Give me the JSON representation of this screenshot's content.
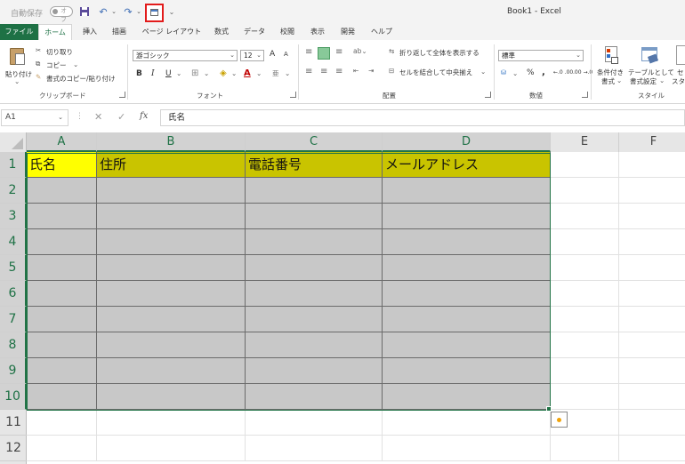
{
  "titlebar": {
    "autosave_label": "自動保存",
    "autosave_state": "オフ",
    "filename": "Book1  -  Excel"
  },
  "tabs": [
    "ファイル",
    "ホーム",
    "挿入",
    "描画",
    "ページ レイアウト",
    "数式",
    "データ",
    "校閲",
    "表示",
    "開発",
    "ヘルプ"
  ],
  "ribbon": {
    "clipboard": {
      "paste": "貼り付け",
      "cut": "切り取り",
      "copy": "コピー",
      "format_painter": "書式のコピー/貼り付け",
      "group": "クリップボード"
    },
    "font": {
      "font_name": "游ゴシック",
      "font_size": "12",
      "grow": "A",
      "shrink": "A",
      "bold": "B",
      "italic": "I",
      "underline": "U",
      "font_color": "A",
      "group": "フォント"
    },
    "alignment": {
      "wrap_text": "折り返して全体を表示する",
      "merge_center": "セルを結合して中央揃え",
      "group": "配置"
    },
    "number": {
      "format": "標準",
      "percent": "%",
      "comma": ",",
      "inc_decimal": "←.0 .00",
      "dec_decimal": ".00 →.0",
      "group": "数値"
    },
    "styles": {
      "conditional_line1": "条件付き",
      "conditional_line2": "書式",
      "table_line1": "テーブルとして",
      "table_line2": "書式設定",
      "cell_styles": "セ",
      "cell_styles2": "スタ",
      "group": "スタイル"
    }
  },
  "formula_bar": {
    "name_box": "A1",
    "fx": "fx",
    "content": "氏名"
  },
  "grid": {
    "columns": [
      "A",
      "B",
      "C",
      "D",
      "E",
      "F"
    ],
    "rows": [
      "1",
      "2",
      "3",
      "4",
      "5",
      "6",
      "7",
      "8",
      "9",
      "10",
      "11",
      "12"
    ],
    "header_cells": [
      "氏名",
      "住所",
      "電話番号",
      "メールアドレス"
    ]
  },
  "colors": {
    "excel_green": "#217346",
    "header_fill": "#c9c400",
    "active_header_fill": "#ffff00",
    "body_fill": "#c8c8c8",
    "highlight_box": "#e21b1b"
  }
}
